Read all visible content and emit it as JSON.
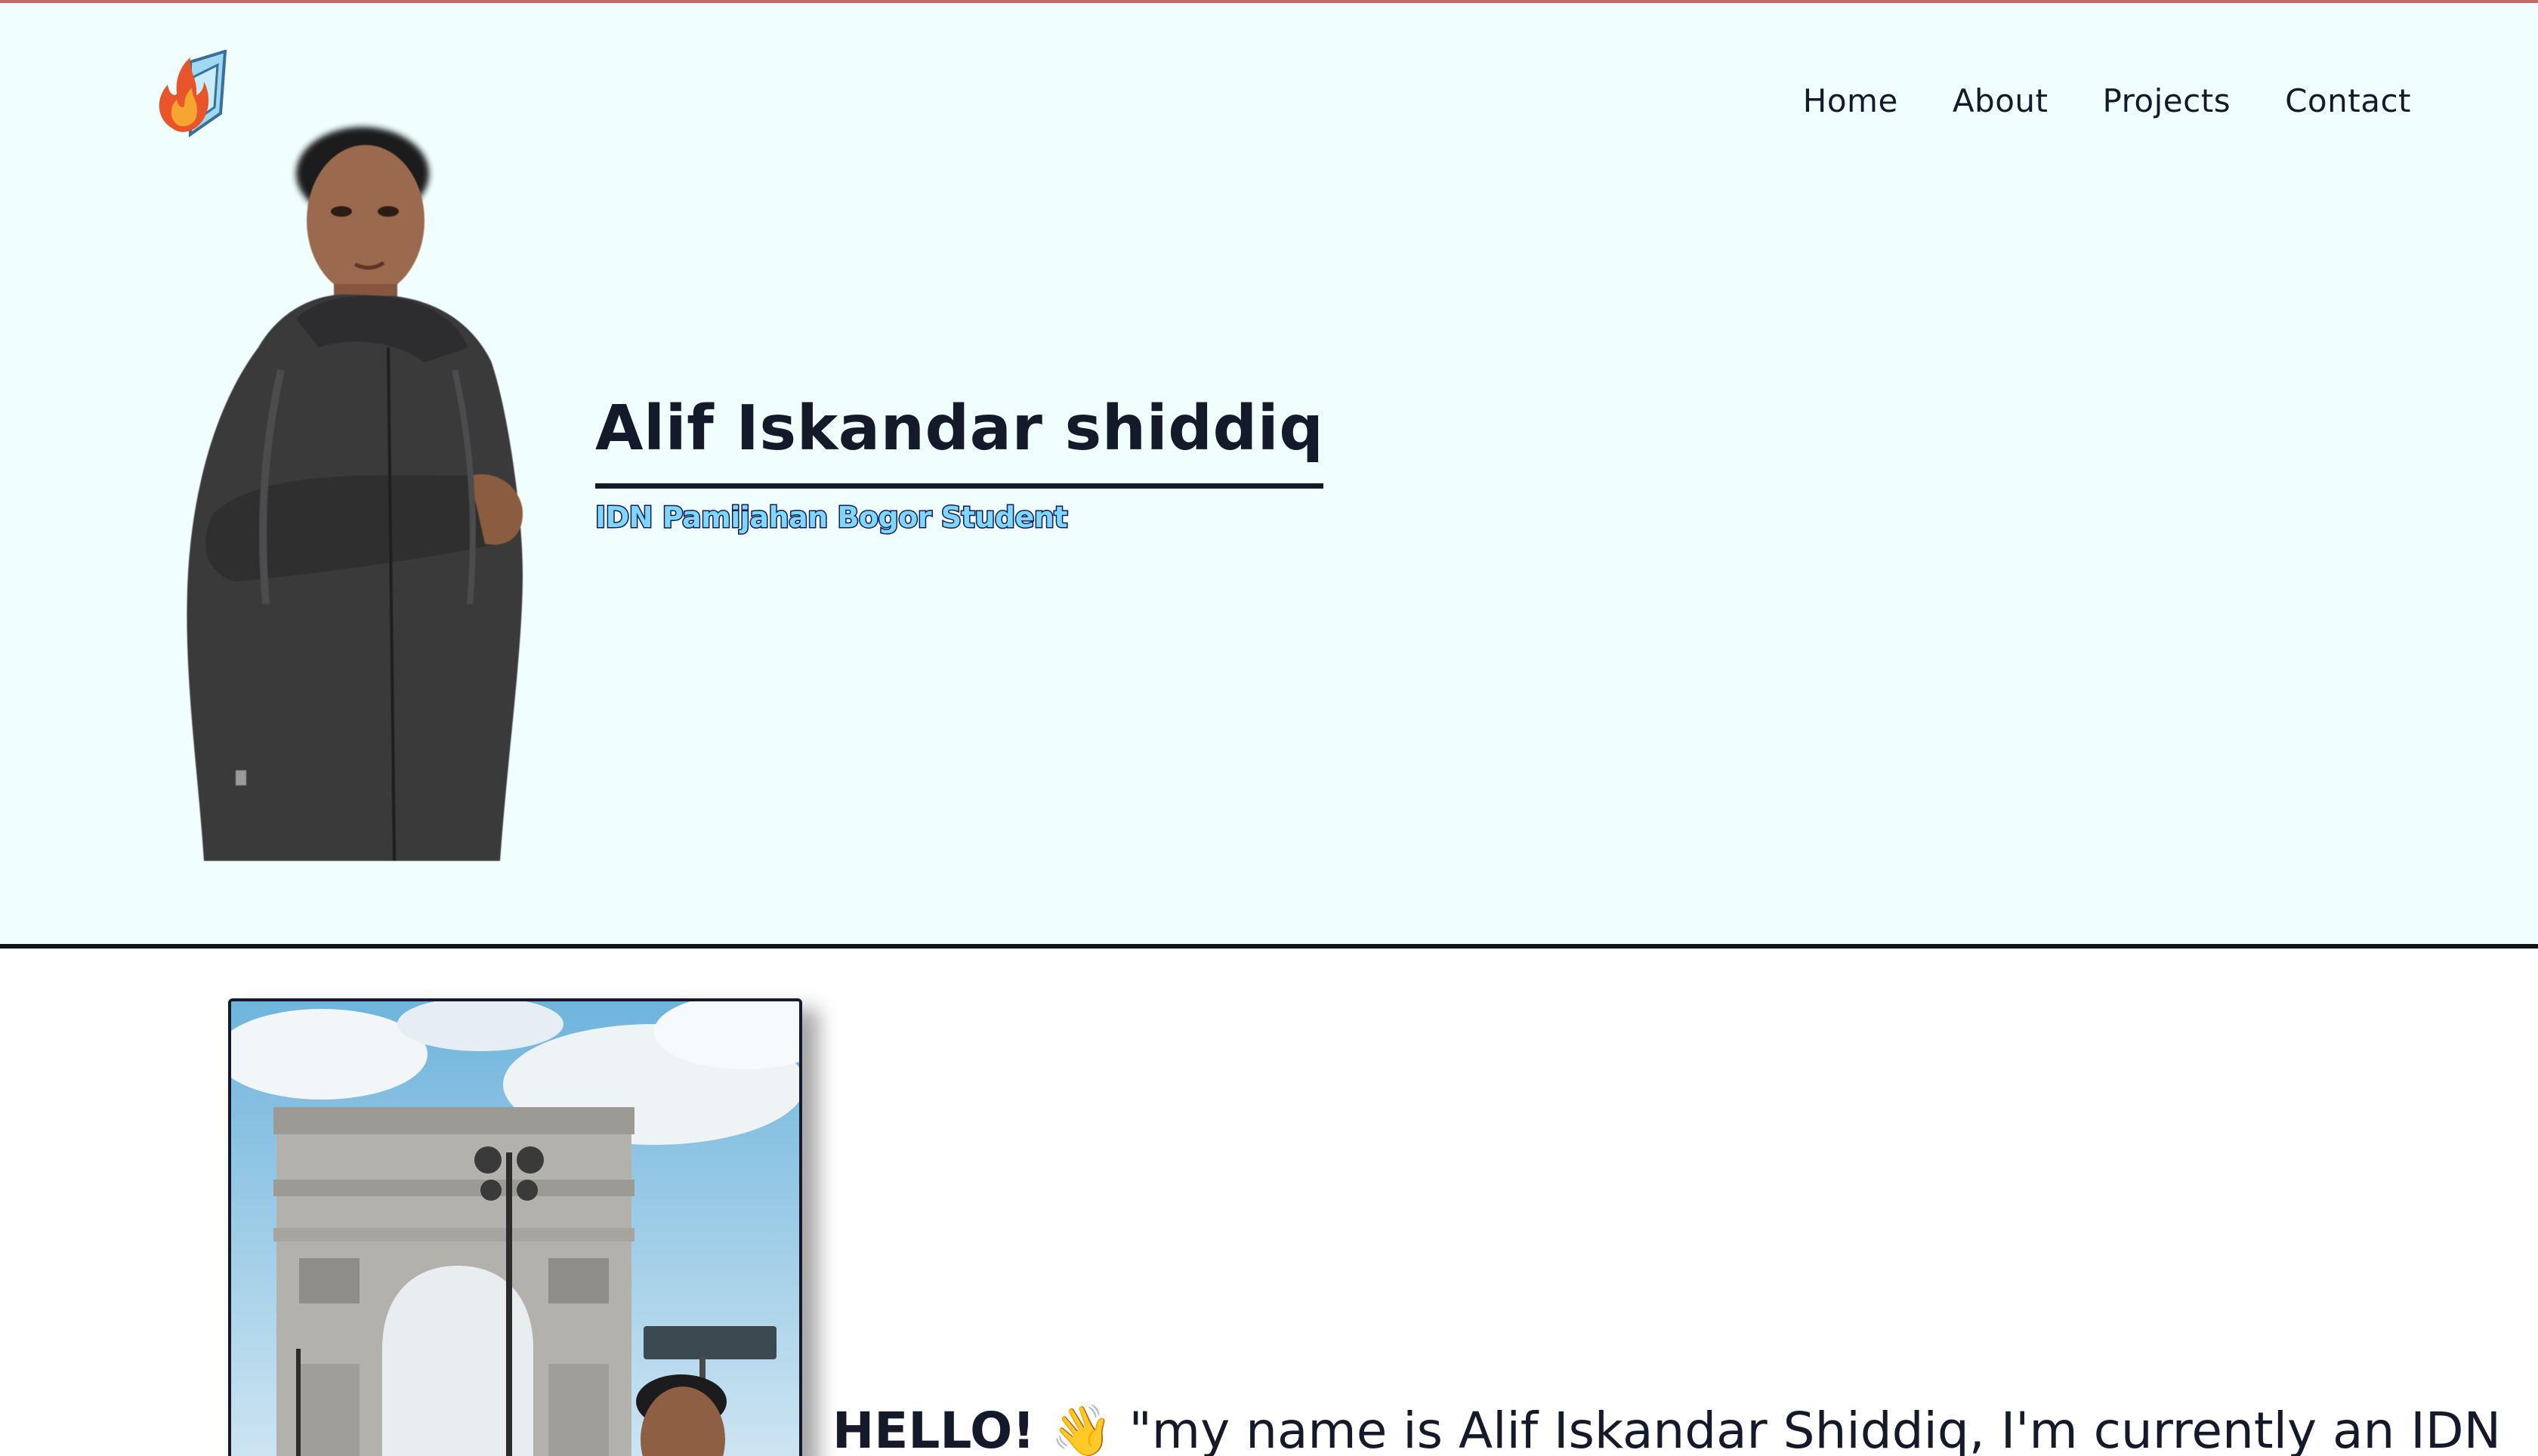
{
  "nav": {
    "logo_icon": "flame-book-logo-icon",
    "links": [
      "Home",
      "About",
      "Projects",
      "Contact"
    ]
  },
  "hero": {
    "name": "Alif Iskandar shiddiq",
    "subtitle": "IDN Pamijahan Bogor Student"
  },
  "about": {
    "greeting": "HELLO!",
    "wave_emoji": "👋",
    "intro": "\"my name is Alif Iskandar Shiddiq, I'm currently an IDN"
  },
  "colors": {
    "hero_bg": "#f0fefe",
    "text": "#141a29",
    "subtitle_fill": "#7fd6ff",
    "subtitle_stroke": "#111c55"
  }
}
